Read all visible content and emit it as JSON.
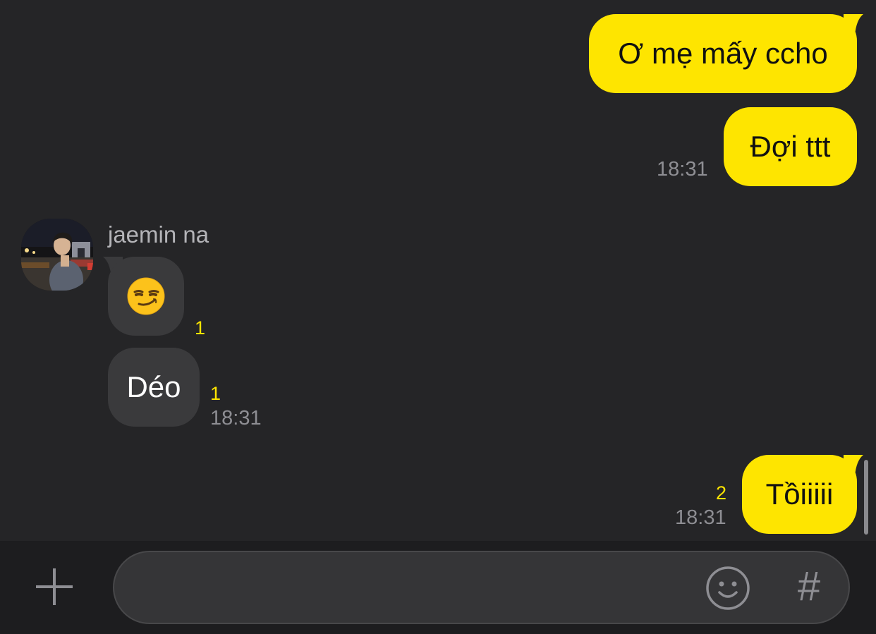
{
  "messages": [
    {
      "direction": "outgoing",
      "text": "Ơ mẹ mấy ccho"
    },
    {
      "direction": "outgoing",
      "text": "Đợi ttt",
      "time": "18:31"
    },
    {
      "direction": "incoming",
      "sender": "jaemin na",
      "text": "😏",
      "unread": "1"
    },
    {
      "direction": "incoming",
      "text": "Déo",
      "unread": "1",
      "time": "18:31"
    },
    {
      "direction": "outgoing",
      "text": "Tồiiiii",
      "unread": "2",
      "time": "18:31"
    }
  ],
  "composer": {
    "placeholder": "",
    "hash_label": "#"
  },
  "icons": {
    "plus": "plus-icon",
    "emoji": "smiley-icon",
    "hash": "hash-icon"
  },
  "colors": {
    "background": "#252527",
    "outgoing_bubble": "#fee500",
    "incoming_bubble": "#3a3a3c",
    "unread_count": "#fee500",
    "timestamp": "#8e8e93"
  }
}
